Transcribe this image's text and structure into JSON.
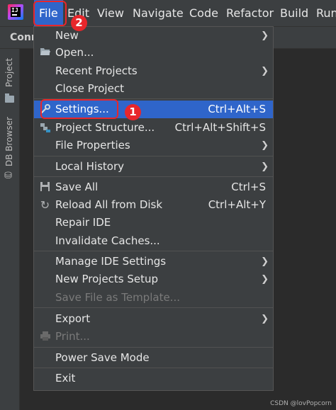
{
  "menubar": {
    "items": [
      {
        "label": "File",
        "active": true
      },
      {
        "label": "Edit"
      },
      {
        "label": "View"
      },
      {
        "label": "Navigate"
      },
      {
        "label": "Code"
      },
      {
        "label": "Refactor"
      },
      {
        "label": "Build"
      },
      {
        "label": "Run"
      }
    ]
  },
  "toolbar": {
    "project_name": "Conn"
  },
  "left_stripe": {
    "project_label": "Project",
    "db_browser_label": "DB Browser"
  },
  "file_menu": {
    "items": [
      {
        "label": "New",
        "submenu": true
      },
      {
        "label": "Open...",
        "icon": "folder-open-icon"
      },
      {
        "label": "Recent Projects",
        "submenu": true
      },
      {
        "label": "Close Project"
      },
      {
        "label": "Settings...",
        "shortcut": "Ctrl+Alt+S",
        "icon": "wrench-icon",
        "selected": true
      },
      {
        "label": "Project Structure...",
        "shortcut": "Ctrl+Alt+Shift+S",
        "icon": "project-structure-icon"
      },
      {
        "label": "File Properties",
        "submenu": true
      },
      {
        "label": "Local History",
        "submenu": true
      },
      {
        "label": "Save All",
        "shortcut": "Ctrl+S",
        "icon": "save-icon"
      },
      {
        "label": "Reload All from Disk",
        "shortcut": "Ctrl+Alt+Y",
        "icon": "reload-icon"
      },
      {
        "label": "Repair IDE"
      },
      {
        "label": "Invalidate Caches..."
      },
      {
        "label": "Manage IDE Settings",
        "submenu": true
      },
      {
        "label": "New Projects Setup",
        "submenu": true
      },
      {
        "label": "Save File as Template...",
        "disabled": true
      },
      {
        "label": "Export",
        "submenu": true
      },
      {
        "label": "Print...",
        "icon": "print-icon",
        "disabled": true
      },
      {
        "label": "Power Save Mode"
      },
      {
        "label": "Exit"
      }
    ]
  },
  "annotations": {
    "badge_1": "1",
    "badge_2": "2",
    "color": "#e8262b"
  },
  "watermark": "CSDN @lovPopcorn",
  "colors": {
    "accent": "#2f65ca",
    "menu_bg": "#3c3f41",
    "editor_bg": "#2b2b2b"
  }
}
